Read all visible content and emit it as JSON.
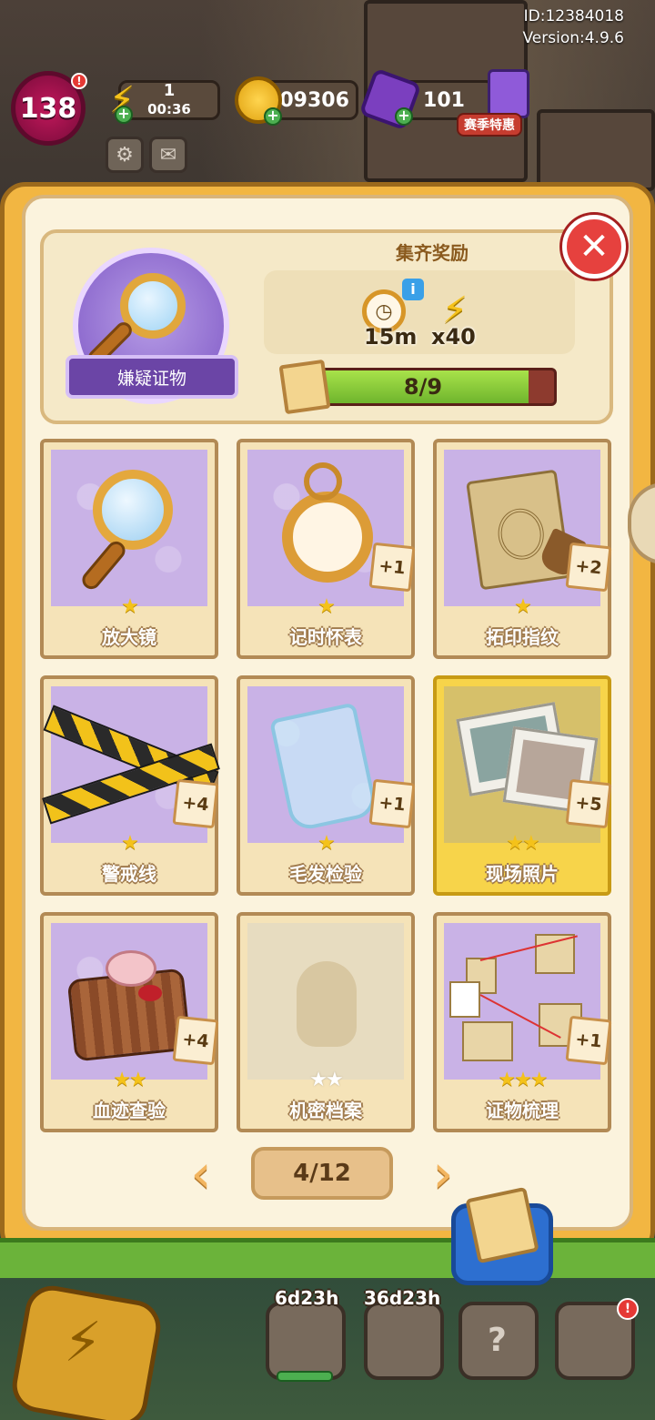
{
  "hud": {
    "user_id": "ID:12384018",
    "version": "Version:4.9.6",
    "level": "138",
    "energy_value": "1",
    "energy_timer": "00:36",
    "coins": "109306",
    "gems": "101",
    "season_special": "赛季特惠"
  },
  "collection": {
    "name": "嫌疑证物",
    "reward_title": "集齐奖励",
    "reward_time": "15m",
    "reward_energy": "x40",
    "progress_text": "8/9",
    "progress_collected": 8,
    "progress_total": 9
  },
  "cards": [
    {
      "label": "放大镜",
      "stars": "★",
      "dup": ""
    },
    {
      "label": "记时怀表",
      "stars": "★",
      "dup": "+1"
    },
    {
      "label": "拓印指纹",
      "stars": "★",
      "dup": "+2"
    },
    {
      "label": "警戒线",
      "stars": "★",
      "dup": "+4"
    },
    {
      "label": "毛发检验",
      "stars": "★",
      "dup": "+1"
    },
    {
      "label": "现场照片",
      "stars": "★★",
      "dup": "+5"
    },
    {
      "label": "血迹查验",
      "stars": "★★",
      "dup": "+4"
    },
    {
      "label": "机密档案",
      "stars": "★★",
      "dup": ""
    },
    {
      "label": "证物梳理",
      "stars": "★★★",
      "dup": "+1"
    }
  ],
  "pager": {
    "page": "4/12",
    "prev": "‹",
    "next": "›"
  },
  "bottom": {
    "timer1": "6d23h",
    "timer2": "36d23h"
  },
  "icons": {
    "close": "✕",
    "info": "i",
    "bolt": "⚡",
    "alert": "!"
  }
}
